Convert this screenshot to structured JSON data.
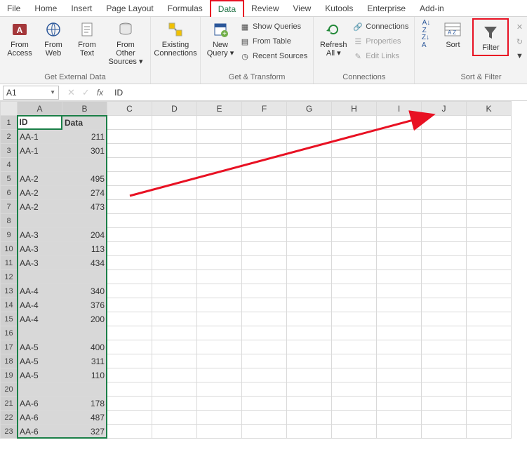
{
  "tabs": [
    "File",
    "Home",
    "Insert",
    "Page Layout",
    "Formulas",
    "Data",
    "Review",
    "View",
    "Kutools",
    "Enterprise",
    "Add-in"
  ],
  "active_tab": "Data",
  "ribbon": {
    "get_external": {
      "label": "Get External Data",
      "from_access": "From Access",
      "from_web": "From Web",
      "from_text": "From Text",
      "from_other": "From Other Sources ▾"
    },
    "existing_connections": "Existing Connections",
    "get_transform": {
      "label": "Get & Transform",
      "new_query": "New Query ▾",
      "show_queries": "Show Queries",
      "from_table": "From Table",
      "recent_sources": "Recent Sources"
    },
    "connections_grp": {
      "label": "Connections",
      "refresh_all": "Refresh All ▾",
      "connections": "Connections",
      "properties": "Properties",
      "edit_links": "Edit Links"
    },
    "sort_filter": {
      "label": "Sort & Filter",
      "sort": "Sort",
      "filter": "Filter",
      "clear": "Cle",
      "reapply": "Rea",
      "advanced": "Ad"
    }
  },
  "name_box": "A1",
  "formula_value": "ID",
  "columns": [
    "A",
    "B",
    "C",
    "D",
    "E",
    "F",
    "G",
    "H",
    "I",
    "J",
    "K"
  ],
  "row_count": 23,
  "headers": {
    "a": "ID",
    "b": "Data"
  },
  "rows": [
    {
      "a": "AA-1",
      "b": 211
    },
    {
      "a": "AA-1",
      "b": 301
    },
    {
      "a": "",
      "b": ""
    },
    {
      "a": "AA-2",
      "b": 495
    },
    {
      "a": "AA-2",
      "b": 274
    },
    {
      "a": "AA-2",
      "b": 473
    },
    {
      "a": "",
      "b": ""
    },
    {
      "a": "AA-3",
      "b": 204
    },
    {
      "a": "AA-3",
      "b": 113
    },
    {
      "a": "AA-3",
      "b": 434
    },
    {
      "a": "",
      "b": ""
    },
    {
      "a": "AA-4",
      "b": 340
    },
    {
      "a": "AA-4",
      "b": 376
    },
    {
      "a": "AA-4",
      "b": 200
    },
    {
      "a": "",
      "b": ""
    },
    {
      "a": "AA-5",
      "b": 400
    },
    {
      "a": "AA-5",
      "b": 311
    },
    {
      "a": "AA-5",
      "b": 110
    },
    {
      "a": "",
      "b": ""
    },
    {
      "a": "AA-6",
      "b": 178
    },
    {
      "a": "AA-6",
      "b": 487
    },
    {
      "a": "AA-6",
      "b": 327
    }
  ],
  "colors": {
    "highlight": "#e81123",
    "excel_green": "#1a7f47"
  }
}
